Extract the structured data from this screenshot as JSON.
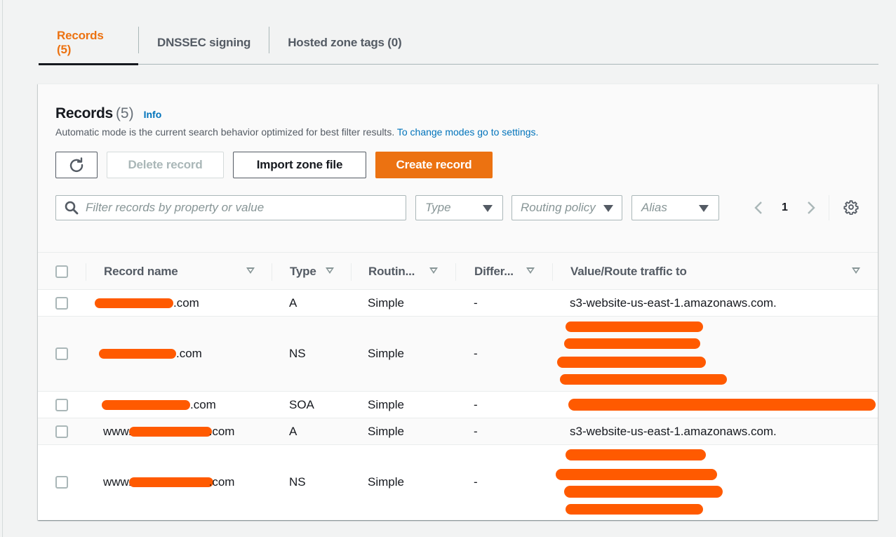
{
  "tabs": [
    {
      "label": "Records (5)",
      "active": true
    },
    {
      "label": "DNSSEC signing",
      "active": false
    },
    {
      "label": "Hosted zone tags (0)",
      "active": false
    }
  ],
  "records_panel": {
    "title": "Records",
    "count": "(5)",
    "info_label": "Info",
    "description": "Automatic mode is the current search behavior optimized for best filter results.",
    "settings_link": "To change modes go to settings."
  },
  "actions": {
    "refresh_icon": "refresh-icon",
    "delete_label": "Delete record",
    "delete_enabled": false,
    "import_label": "Import zone file",
    "create_label": "Create record"
  },
  "filters": {
    "search_placeholder": "Filter records by property or value",
    "search_value": "",
    "type_placeholder": "Type",
    "routing_placeholder": "Routing policy",
    "alias_placeholder": "Alias"
  },
  "pagination": {
    "current_page": "1",
    "prev_enabled": false,
    "next_enabled": false
  },
  "colors": {
    "accent": "#ec7211",
    "link": "#0073bb",
    "redaction": "#ff5a00"
  },
  "table": {
    "columns": [
      {
        "label": "Record name"
      },
      {
        "label": "Type"
      },
      {
        "label": "Routin..."
      },
      {
        "label": "Differ..."
      },
      {
        "label": "Value/Route traffic to"
      }
    ],
    "rows": [
      {
        "name_prefix": "",
        "name_redacted": true,
        "name_suffix": ".com",
        "type": "A",
        "routing": "Simple",
        "differentiator": "-",
        "value": "s3-website-us-east-1.amazonaws.com.",
        "value_redacted": false
      },
      {
        "name_prefix": "",
        "name_redacted": true,
        "name_suffix": ".com",
        "type": "NS",
        "routing": "Simple",
        "differentiator": "-",
        "value": "[redacted - 4 name servers]",
        "value_redacted": true
      },
      {
        "name_prefix": "",
        "name_redacted": true,
        "name_suffix": ".com",
        "type": "SOA",
        "routing": "Simple",
        "differentiator": "-",
        "value": "[redacted]",
        "value_redacted": true
      },
      {
        "name_prefix": "www.",
        "name_redacted": true,
        "name_suffix": ".com",
        "type": "A",
        "routing": "Simple",
        "differentiator": "-",
        "value": "s3-website-us-east-1.amazonaws.com.",
        "value_redacted": false
      },
      {
        "name_prefix": "www.",
        "name_redacted": true,
        "name_suffix": ".com",
        "type": "NS",
        "routing": "Simple",
        "differentiator": "-",
        "value": "[redacted - 4 name servers]",
        "value_redacted": true
      }
    ]
  }
}
